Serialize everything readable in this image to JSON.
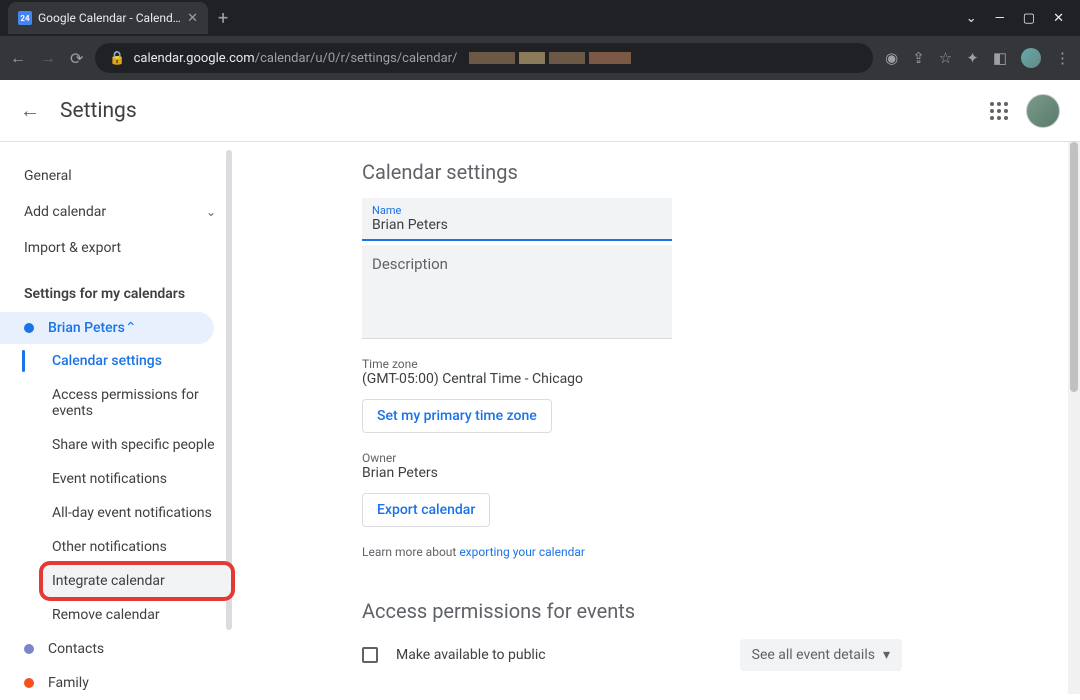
{
  "browser": {
    "tab": {
      "title": "Google Calendar - Calendar setti",
      "favicon_day": "24"
    },
    "url_prefix": "calendar.google.com",
    "url_path": "/calendar/u/0/r/settings/calendar/"
  },
  "header": {
    "title": "Settings"
  },
  "sidebar": {
    "items": [
      {
        "label": "General"
      },
      {
        "label": "Add calendar"
      },
      {
        "label": "Import & export"
      }
    ],
    "section_label": "Settings for my calendars",
    "active_calendar": {
      "label": "Brian Peters",
      "color": "#1a73e8"
    },
    "sub_items": [
      {
        "label": "Calendar settings"
      },
      {
        "label": "Access permissions for events"
      },
      {
        "label": "Share with specific people"
      },
      {
        "label": "Event notifications"
      },
      {
        "label": "All-day event notifications"
      },
      {
        "label": "Other notifications"
      },
      {
        "label": "Integrate calendar"
      },
      {
        "label": "Remove calendar"
      }
    ],
    "other_calendars": [
      {
        "label": "Contacts",
        "color": "#7986cb"
      },
      {
        "label": "Family",
        "color": "#f4511e"
      }
    ]
  },
  "main": {
    "title": "Calendar settings",
    "name_field": {
      "label": "Name",
      "value": "Brian Peters"
    },
    "description_placeholder": "Description",
    "timezone": {
      "label": "Time zone",
      "value": "(GMT-05:00) Central Time - Chicago"
    },
    "btn_set_tz": "Set my primary time zone",
    "owner": {
      "label": "Owner",
      "value": "Brian Peters"
    },
    "btn_export": "Export calendar",
    "learn_prefix": "Learn more about ",
    "learn_link": "exporting your calendar",
    "section2": "Access permissions for events",
    "make_public": "Make available to public",
    "dropdown_public": "See all event details"
  }
}
